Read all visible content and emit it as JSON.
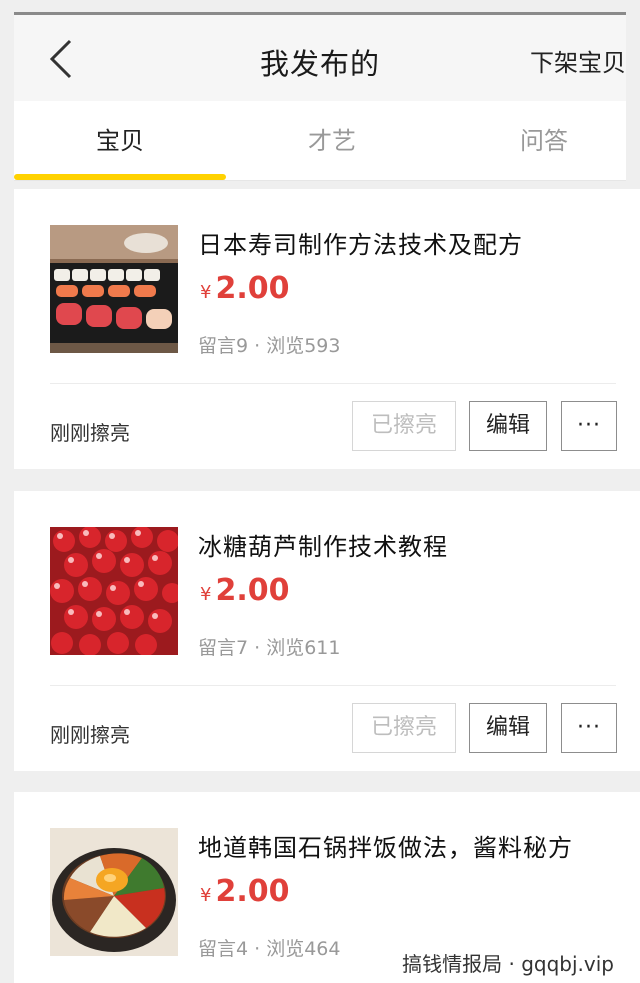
{
  "header": {
    "back_icon": "chevron-left-icon",
    "title": "我发布的",
    "right_action": "下架宝贝"
  },
  "tabs": [
    {
      "label": "宝贝",
      "active": true
    },
    {
      "label": "才艺",
      "active": false
    },
    {
      "label": "问答",
      "active": false
    }
  ],
  "colors": {
    "accent_yellow": "#ffd200",
    "price_red": "#e0403a"
  },
  "items": [
    {
      "title": "日本寿司制作方法技术及配方",
      "currency": "¥",
      "price": "2.00",
      "stats": "留言9 · 浏览593",
      "status": "刚刚擦亮",
      "buttons": {
        "polished": "已擦亮",
        "edit": "编辑",
        "more": "···"
      },
      "thumbnail": "sushi-image"
    },
    {
      "title": "冰糖葫芦制作技术教程",
      "currency": "¥",
      "price": "2.00",
      "stats": "留言7 · 浏览611",
      "status": "刚刚擦亮",
      "buttons": {
        "polished": "已擦亮",
        "edit": "编辑",
        "more": "···"
      },
      "thumbnail": "tanghulu-image"
    },
    {
      "title": "地道韩国石锅拌饭做法，酱料秘方",
      "currency": "¥",
      "price": "2.00",
      "stats": "留言4 · 浏览464",
      "thumbnail": "bibimbap-image"
    }
  ],
  "watermark": "搞钱情报局 · gqqbj.vip"
}
